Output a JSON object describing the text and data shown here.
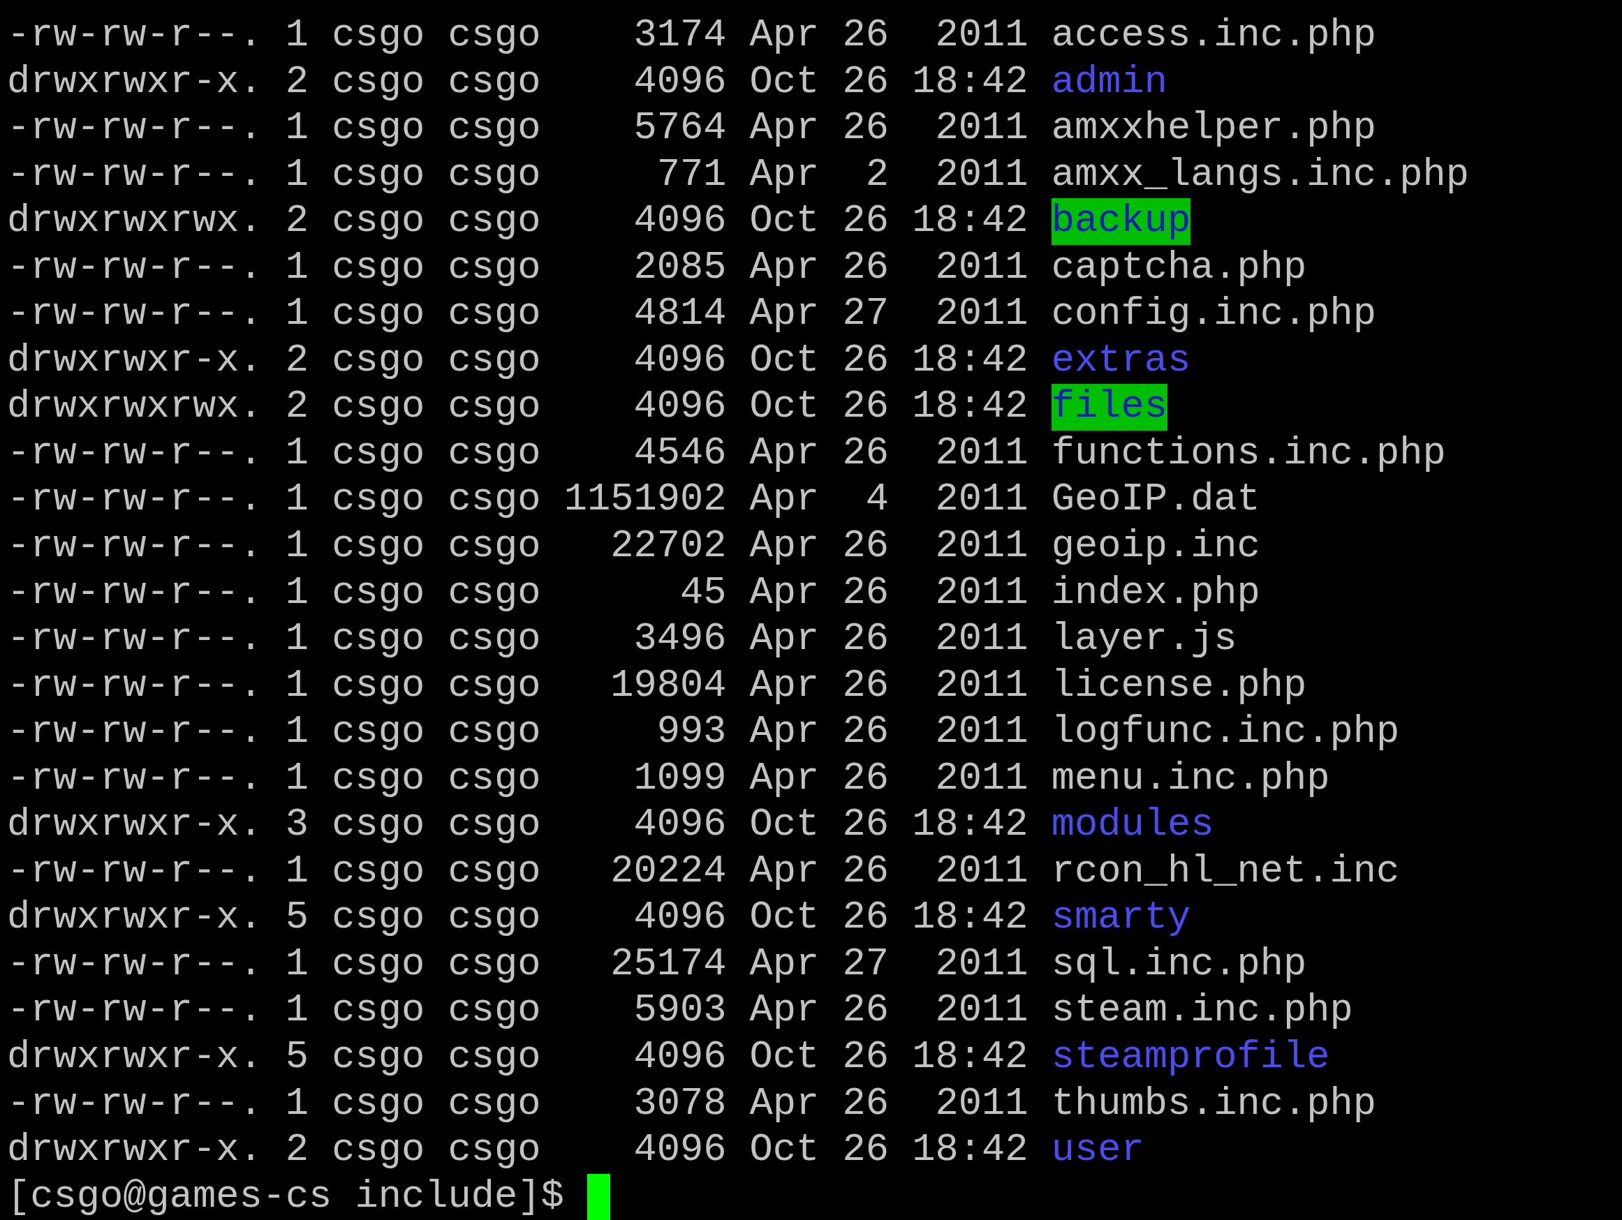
{
  "terminal": {
    "listing": [
      {
        "permissions": "-rw-rw-r--.",
        "links": "1",
        "owner": "csgo",
        "group": "csgo",
        "size": "3174",
        "month": "Apr",
        "day": "26",
        "time": "2011",
        "name": "access.inc.php",
        "kind": "file"
      },
      {
        "permissions": "drwxrwxr-x.",
        "links": "2",
        "owner": "csgo",
        "group": "csgo",
        "size": "4096",
        "month": "Oct",
        "day": "26",
        "time": "18:42",
        "name": "admin",
        "kind": "dir"
      },
      {
        "permissions": "-rw-rw-r--.",
        "links": "1",
        "owner": "csgo",
        "group": "csgo",
        "size": "5764",
        "month": "Apr",
        "day": "26",
        "time": "2011",
        "name": "amxxhelper.php",
        "kind": "file"
      },
      {
        "permissions": "-rw-rw-r--.",
        "links": "1",
        "owner": "csgo",
        "group": "csgo",
        "size": "771",
        "month": "Apr",
        "day": "2",
        "time": "2011",
        "name": "amxx_langs.inc.php",
        "kind": "file"
      },
      {
        "permissions": "drwxrwxrwx.",
        "links": "2",
        "owner": "csgo",
        "group": "csgo",
        "size": "4096",
        "month": "Oct",
        "day": "26",
        "time": "18:42",
        "name": "backup",
        "kind": "writable"
      },
      {
        "permissions": "-rw-rw-r--.",
        "links": "1",
        "owner": "csgo",
        "group": "csgo",
        "size": "2085",
        "month": "Apr",
        "day": "26",
        "time": "2011",
        "name": "captcha.php",
        "kind": "file"
      },
      {
        "permissions": "-rw-rw-r--.",
        "links": "1",
        "owner": "csgo",
        "group": "csgo",
        "size": "4814",
        "month": "Apr",
        "day": "27",
        "time": "2011",
        "name": "config.inc.php",
        "kind": "file"
      },
      {
        "permissions": "drwxrwxr-x.",
        "links": "2",
        "owner": "csgo",
        "group": "csgo",
        "size": "4096",
        "month": "Oct",
        "day": "26",
        "time": "18:42",
        "name": "extras",
        "kind": "dir"
      },
      {
        "permissions": "drwxrwxrwx.",
        "links": "2",
        "owner": "csgo",
        "group": "csgo",
        "size": "4096",
        "month": "Oct",
        "day": "26",
        "time": "18:42",
        "name": "files",
        "kind": "writable"
      },
      {
        "permissions": "-rw-rw-r--.",
        "links": "1",
        "owner": "csgo",
        "group": "csgo",
        "size": "4546",
        "month": "Apr",
        "day": "26",
        "time": "2011",
        "name": "functions.inc.php",
        "kind": "file"
      },
      {
        "permissions": "-rw-rw-r--.",
        "links": "1",
        "owner": "csgo",
        "group": "csgo",
        "size": "1151902",
        "month": "Apr",
        "day": "4",
        "time": "2011",
        "name": "GeoIP.dat",
        "kind": "file"
      },
      {
        "permissions": "-rw-rw-r--.",
        "links": "1",
        "owner": "csgo",
        "group": "csgo",
        "size": "22702",
        "month": "Apr",
        "day": "26",
        "time": "2011",
        "name": "geoip.inc",
        "kind": "file"
      },
      {
        "permissions": "-rw-rw-r--.",
        "links": "1",
        "owner": "csgo",
        "group": "csgo",
        "size": "45",
        "month": "Apr",
        "day": "26",
        "time": "2011",
        "name": "index.php",
        "kind": "file"
      },
      {
        "permissions": "-rw-rw-r--.",
        "links": "1",
        "owner": "csgo",
        "group": "csgo",
        "size": "3496",
        "month": "Apr",
        "day": "26",
        "time": "2011",
        "name": "layer.js",
        "kind": "file"
      },
      {
        "permissions": "-rw-rw-r--.",
        "links": "1",
        "owner": "csgo",
        "group": "csgo",
        "size": "19804",
        "month": "Apr",
        "day": "26",
        "time": "2011",
        "name": "license.php",
        "kind": "file"
      },
      {
        "permissions": "-rw-rw-r--.",
        "links": "1",
        "owner": "csgo",
        "group": "csgo",
        "size": "993",
        "month": "Apr",
        "day": "26",
        "time": "2011",
        "name": "logfunc.inc.php",
        "kind": "file"
      },
      {
        "permissions": "-rw-rw-r--.",
        "links": "1",
        "owner": "csgo",
        "group": "csgo",
        "size": "1099",
        "month": "Apr",
        "day": "26",
        "time": "2011",
        "name": "menu.inc.php",
        "kind": "file"
      },
      {
        "permissions": "drwxrwxr-x.",
        "links": "3",
        "owner": "csgo",
        "group": "csgo",
        "size": "4096",
        "month": "Oct",
        "day": "26",
        "time": "18:42",
        "name": "modules",
        "kind": "dir"
      },
      {
        "permissions": "-rw-rw-r--.",
        "links": "1",
        "owner": "csgo",
        "group": "csgo",
        "size": "20224",
        "month": "Apr",
        "day": "26",
        "time": "2011",
        "name": "rcon_hl_net.inc",
        "kind": "file"
      },
      {
        "permissions": "drwxrwxr-x.",
        "links": "5",
        "owner": "csgo",
        "group": "csgo",
        "size": "4096",
        "month": "Oct",
        "day": "26",
        "time": "18:42",
        "name": "smarty",
        "kind": "dir"
      },
      {
        "permissions": "-rw-rw-r--.",
        "links": "1",
        "owner": "csgo",
        "group": "csgo",
        "size": "25174",
        "month": "Apr",
        "day": "27",
        "time": "2011",
        "name": "sql.inc.php",
        "kind": "file"
      },
      {
        "permissions": "-rw-rw-r--.",
        "links": "1",
        "owner": "csgo",
        "group": "csgo",
        "size": "5903",
        "month": "Apr",
        "day": "26",
        "time": "2011",
        "name": "steam.inc.php",
        "kind": "file"
      },
      {
        "permissions": "drwxrwxr-x.",
        "links": "5",
        "owner": "csgo",
        "group": "csgo",
        "size": "4096",
        "month": "Oct",
        "day": "26",
        "time": "18:42",
        "name": "steamprofile",
        "kind": "dir"
      },
      {
        "permissions": "-rw-rw-r--.",
        "links": "1",
        "owner": "csgo",
        "group": "csgo",
        "size": "3078",
        "month": "Apr",
        "day": "26",
        "time": "2011",
        "name": "thumbs.inc.php",
        "kind": "file"
      },
      {
        "permissions": "drwxrwxr-x.",
        "links": "2",
        "owner": "csgo",
        "group": "csgo",
        "size": "4096",
        "month": "Oct",
        "day": "26",
        "time": "18:42",
        "name": "user",
        "kind": "dir"
      }
    ],
    "prompt": "[csgo@games-cs include]$"
  }
}
